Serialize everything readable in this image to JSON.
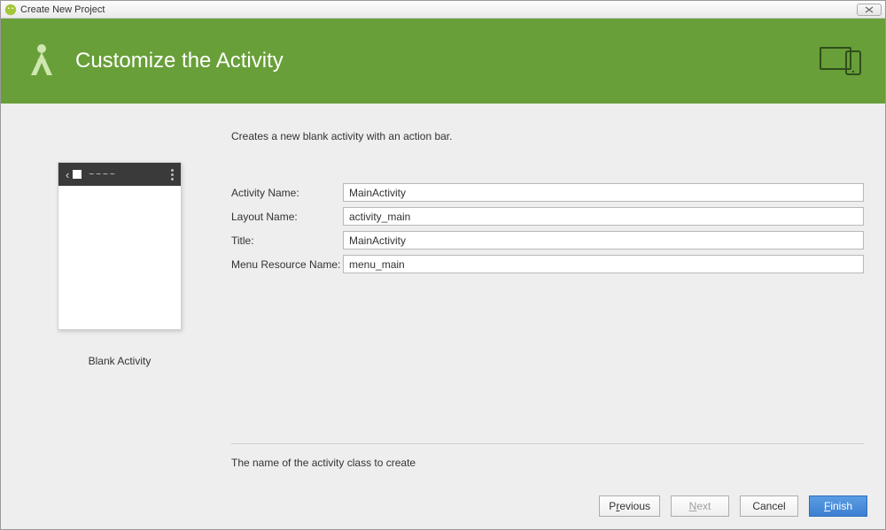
{
  "window": {
    "title": "Create New Project"
  },
  "header": {
    "title": "Customize the Activity"
  },
  "main": {
    "description": "Creates a new blank activity with an action bar.",
    "previewCaption": "Blank Activity",
    "helpText": "The name of the activity class to create"
  },
  "form": {
    "activityName": {
      "label": "Activity Name:",
      "value": "MainActivity"
    },
    "layoutName": {
      "label": "Layout Name:",
      "value": "activity_main"
    },
    "title": {
      "label": "Title:",
      "value": "MainActivity"
    },
    "menuResource": {
      "label": "Menu Resource Name:",
      "value": "menu_main"
    }
  },
  "buttons": {
    "previous_pre": "P",
    "previous_u": "r",
    "previous_post": "evious",
    "next_u": "N",
    "next_post": "ext",
    "cancel": "Cancel",
    "finish_u": "F",
    "finish_post": "inish"
  }
}
